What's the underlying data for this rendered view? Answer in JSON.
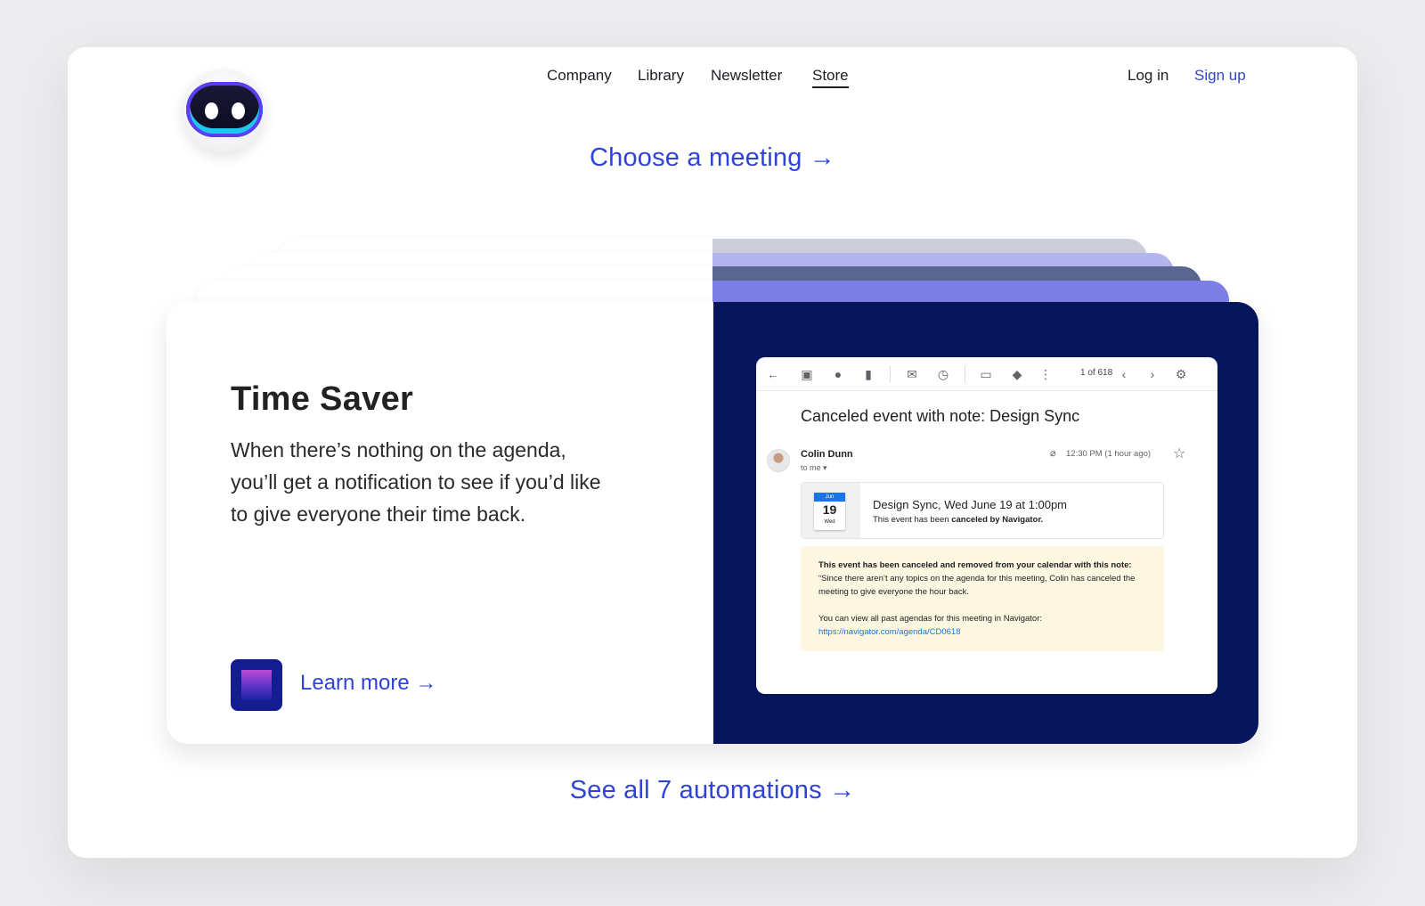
{
  "nav": {
    "items": [
      {
        "label": "Company"
      },
      {
        "label": "Library"
      },
      {
        "label": "Newsletter"
      },
      {
        "label": "Store"
      }
    ],
    "login": "Log in",
    "signup": "Sign up"
  },
  "hero": {
    "choose_link": "Choose a meeting →"
  },
  "feature": {
    "title": "Time Saver",
    "description": "When there’s nothing on the agenda, you’ll get a notification to see if you’d like to give everyone their time back.",
    "learn_more": "Learn more →"
  },
  "email": {
    "pager": "1 of 618",
    "subject": "Canceled event with note: Design Sync",
    "sender": "Colin Dunn",
    "to": "to me ▾",
    "timestamp": "12:30 PM (1 hour ago)",
    "event": {
      "cal_month": "Jun",
      "cal_day": "19",
      "cal_dow": "Wed",
      "title": "Design Sync, Wed June 19 at 1:00pm",
      "sub_prefix": "This event has been ",
      "sub_bold": "canceled by Navigator."
    },
    "note": {
      "heading": "This event has been canceled and removed from your calendar with this note:",
      "body": "“Since there aren’t any topics on the agenda for this meeting, Colin has canceled the meeting to give everyone the hour back.",
      "past": "You can view all past agendas for this meeting in Navigator:",
      "url": "https://navigator.com/agenda/CD0618"
    }
  },
  "footer": {
    "see_all": "See all 7 automations →"
  },
  "colors": {
    "accent": "#2f44d6",
    "card_dark": "#06155c",
    "stack_1": "#7c7fe6",
    "stack_2": "#5b6592",
    "stack_3": "#b2b5ee",
    "stack_4": "#ccced9",
    "note_bg": "#fdf7e1"
  }
}
